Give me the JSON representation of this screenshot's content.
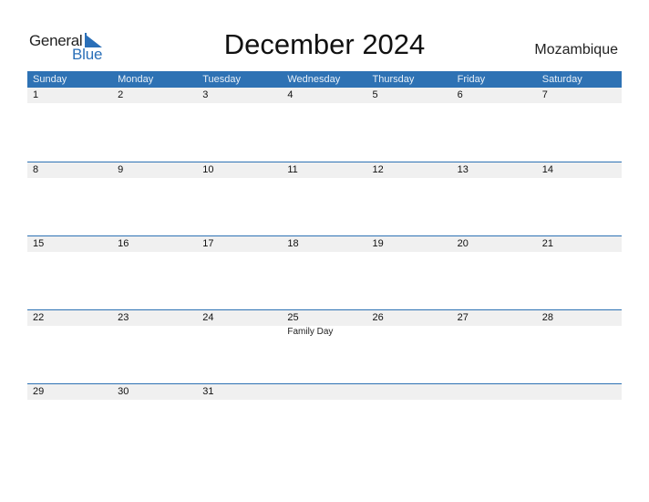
{
  "logo": {
    "line1": "General",
    "line2": "Blue"
  },
  "title": "December 2024",
  "country": "Mozambique",
  "colors": {
    "header_bg": "#2e72b4",
    "band_bg": "#f0f0f0",
    "brand_blue": "#2a6fb8"
  },
  "weekdays": [
    "Sunday",
    "Monday",
    "Tuesday",
    "Wednesday",
    "Thursday",
    "Friday",
    "Saturday"
  ],
  "weeks": [
    {
      "days": [
        "1",
        "2",
        "3",
        "4",
        "5",
        "6",
        "7"
      ],
      "events": [
        "",
        "",
        "",
        "",
        "",
        "",
        ""
      ]
    },
    {
      "days": [
        "8",
        "9",
        "10",
        "11",
        "12",
        "13",
        "14"
      ],
      "events": [
        "",
        "",
        "",
        "",
        "",
        "",
        ""
      ]
    },
    {
      "days": [
        "15",
        "16",
        "17",
        "18",
        "19",
        "20",
        "21"
      ],
      "events": [
        "",
        "",
        "",
        "",
        "",
        "",
        ""
      ]
    },
    {
      "days": [
        "22",
        "23",
        "24",
        "25",
        "26",
        "27",
        "28"
      ],
      "events": [
        "",
        "",
        "",
        "Family Day",
        "",
        "",
        ""
      ]
    },
    {
      "days": [
        "29",
        "30",
        "31",
        "",
        "",
        "",
        ""
      ],
      "events": [
        "",
        "",
        "",
        "",
        "",
        "",
        ""
      ]
    }
  ]
}
